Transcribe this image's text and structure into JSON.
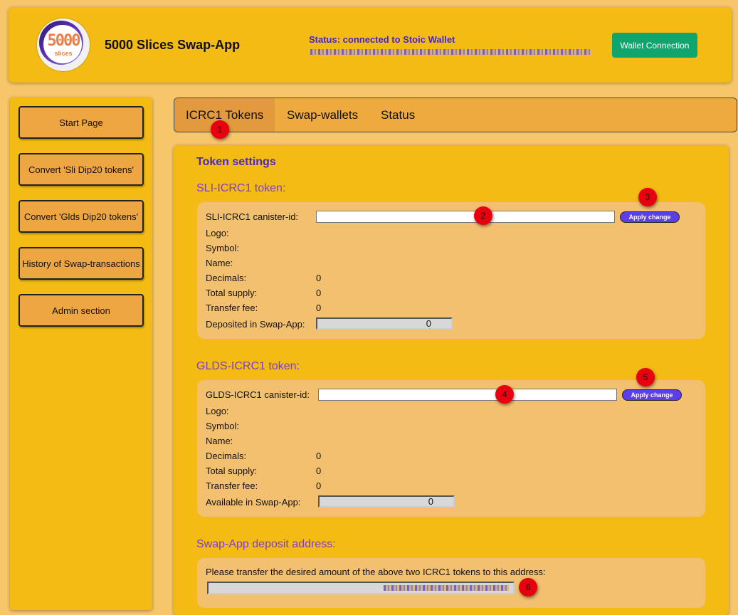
{
  "header": {
    "logo": {
      "number": "5000",
      "sub": "slices"
    },
    "title": "5000 Slices Swap-App",
    "status": "Status: connected to Stoic Wallet",
    "wallet_button": "Wallet Connection"
  },
  "sidebar": {
    "items": [
      {
        "label": "Start Page"
      },
      {
        "label": "Convert 'Sli Dip20 tokens'"
      },
      {
        "label": "Convert 'Glds Dip20 tokens'"
      },
      {
        "label": "History of Swap-transactions"
      },
      {
        "label": "Admin section"
      }
    ]
  },
  "tabs": [
    {
      "label": "ICRC1 Tokens",
      "active": true
    },
    {
      "label": "Swap-wallets"
    },
    {
      "label": "Status"
    }
  ],
  "main": {
    "title": "Token settings",
    "sli": {
      "section_title": "SLI-ICRC1 token:",
      "canister_label": "SLI-ICRC1 canister-id:",
      "canister_value": "",
      "apply_label": "Apply change",
      "logo_label": "Logo:",
      "symbol_label": "Symbol:",
      "name_label": "Name:",
      "decimals_label": "Decimals:",
      "decimals_value": "0",
      "total_supply_label": "Total supply:",
      "total_supply_value": "0",
      "transfer_fee_label": "Transfer fee:",
      "transfer_fee_value": "0",
      "deposited_label": "Deposited in Swap-App:",
      "deposited_value": "0"
    },
    "glds": {
      "section_title": "GLDS-ICRC1 token:",
      "canister_label": "GLDS-ICRC1 canister-id:",
      "canister_value": "",
      "apply_label": "Apply change",
      "logo_label": "Logo:",
      "symbol_label": "Symbol:",
      "name_label": "Name:",
      "decimals_label": "Decimals:",
      "decimals_value": "0",
      "total_supply_label": "Total supply:",
      "total_supply_value": "0",
      "transfer_fee_label": "Transfer fee:",
      "transfer_fee_value": "0",
      "available_label": "Available in Swap-App:",
      "available_value": "0"
    },
    "deposit": {
      "section_title": "Swap-App deposit address:",
      "instruction": "Please transfer the desired amount of the above two ICRC1 tokens to this address:"
    }
  },
  "badges": [
    "1",
    "2",
    "3",
    "4",
    "5",
    "6"
  ],
  "colors": {
    "header_bg": "#f4bb14",
    "page_bg": "#f7c56a",
    "card_bg": "#f2c06f",
    "status_text": "#4228c8",
    "section_title": "#7b40c8",
    "wallet_button": "#0fa56c",
    "apply_button": "#5d3ee8",
    "badge": "#e8000e"
  }
}
